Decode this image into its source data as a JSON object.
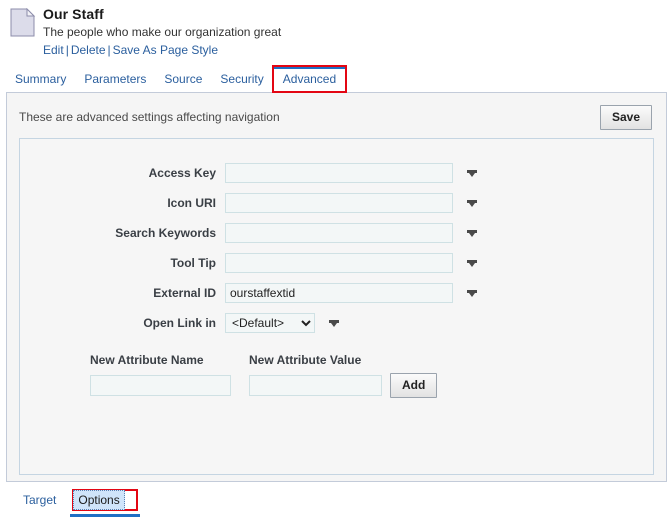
{
  "header": {
    "icon": "page-document-icon",
    "title": "Our Staff",
    "subtitle": "The people who make our organization great",
    "actions": [
      {
        "label": "Edit"
      },
      {
        "label": "Delete"
      },
      {
        "label": "Save As Page Style"
      }
    ],
    "action_separator": "|"
  },
  "tabs": [
    {
      "label": "Summary",
      "active": false
    },
    {
      "label": "Parameters",
      "active": false
    },
    {
      "label": "Source",
      "active": false
    },
    {
      "label": "Security",
      "active": false
    },
    {
      "label": "Advanced",
      "active": true,
      "highlighted": true
    }
  ],
  "panel": {
    "description": "These are advanced settings affecting navigation",
    "save_label": "Save"
  },
  "form": {
    "fields": [
      {
        "label": "Access Key",
        "value": "",
        "placeholder": "",
        "type": "text",
        "has_dropdown": true
      },
      {
        "label": "Icon URI",
        "value": "",
        "placeholder": "",
        "type": "text",
        "has_dropdown": true
      },
      {
        "label": "Search Keywords",
        "value": "",
        "placeholder": "",
        "type": "text",
        "has_dropdown": true
      },
      {
        "label": "Tool Tip",
        "value": "",
        "placeholder": "",
        "type": "text",
        "has_dropdown": true
      },
      {
        "label": "External ID",
        "value": "ourstaffextid",
        "placeholder": "",
        "type": "text",
        "has_dropdown": true
      },
      {
        "label": "Open Link in",
        "value": "<Default>",
        "placeholder": "",
        "type": "select",
        "has_dropdown": true
      }
    ]
  },
  "new_attribute": {
    "name_label": "New Attribute Name",
    "name_value": "",
    "value_label": "New Attribute Value",
    "value_value": "",
    "add_label": "Add"
  },
  "bottom_tabs": [
    {
      "label": "Target",
      "selected": false,
      "highlighted": false
    },
    {
      "label": "Options",
      "selected": true,
      "highlighted": true
    }
  ],
  "colors": {
    "link": "#2b5f9e",
    "accent": "#1f6fc4",
    "highlight": "#e30613",
    "panel_border": "#c3cbd9",
    "inner_border": "#c5d5e2",
    "input_border": "#cfe1e4",
    "selected_tab_bg": "#cfe4fa"
  }
}
